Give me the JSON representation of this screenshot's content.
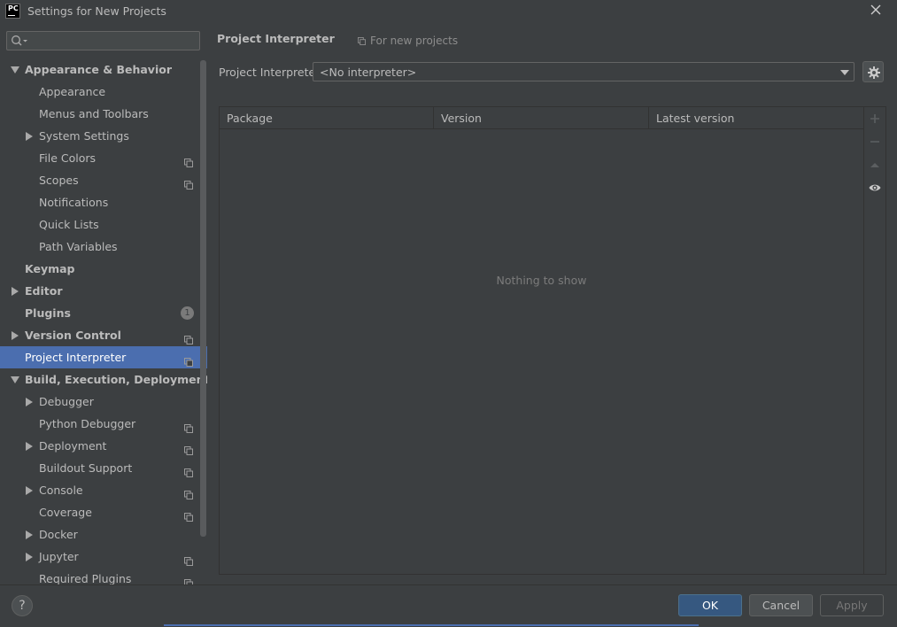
{
  "window": {
    "app_logo_text": "PC",
    "title": "Settings for New Projects"
  },
  "search": {
    "value": "",
    "placeholder": ""
  },
  "tree": [
    {
      "label": "Appearance & Behavior",
      "level": 0,
      "arrow": "down",
      "icon": null,
      "selected": false
    },
    {
      "label": "Appearance",
      "level": 1,
      "arrow": null,
      "icon": null,
      "selected": false
    },
    {
      "label": "Menus and Toolbars",
      "level": 1,
      "arrow": null,
      "icon": null,
      "selected": false
    },
    {
      "label": "System Settings",
      "level": 1,
      "arrow": "right",
      "icon": null,
      "selected": false
    },
    {
      "label": "File Colors",
      "level": 1,
      "arrow": null,
      "icon": "copy",
      "selected": false
    },
    {
      "label": "Scopes",
      "level": 1,
      "arrow": null,
      "icon": "copy",
      "selected": false
    },
    {
      "label": "Notifications",
      "level": 1,
      "arrow": null,
      "icon": null,
      "selected": false
    },
    {
      "label": "Quick Lists",
      "level": 1,
      "arrow": null,
      "icon": null,
      "selected": false
    },
    {
      "label": "Path Variables",
      "level": 1,
      "arrow": null,
      "icon": null,
      "selected": false
    },
    {
      "label": "Keymap",
      "level": 0,
      "arrow": null,
      "icon": null,
      "selected": false
    },
    {
      "label": "Editor",
      "level": 0,
      "arrow": "right",
      "icon": null,
      "selected": false
    },
    {
      "label": "Plugins",
      "level": 0,
      "arrow": null,
      "icon": "badge",
      "badge": "1",
      "selected": false
    },
    {
      "label": "Version Control",
      "level": 0,
      "arrow": "right",
      "icon": "copy",
      "selected": false
    },
    {
      "label": "Project Interpreter",
      "level": 0,
      "arrow": null,
      "icon": "copy",
      "selected": true
    },
    {
      "label": "Build, Execution, Deployment",
      "level": 0,
      "arrow": "down",
      "icon": null,
      "selected": false
    },
    {
      "label": "Debugger",
      "level": 1,
      "arrow": "right",
      "icon": null,
      "selected": false
    },
    {
      "label": "Python Debugger",
      "level": 1,
      "arrow": null,
      "icon": "copy",
      "selected": false
    },
    {
      "label": "Deployment",
      "level": 1,
      "arrow": "right",
      "icon": "copy",
      "selected": false
    },
    {
      "label": "Buildout Support",
      "level": 1,
      "arrow": null,
      "icon": "copy",
      "selected": false
    },
    {
      "label": "Console",
      "level": 1,
      "arrow": "right",
      "icon": "copy",
      "selected": false
    },
    {
      "label": "Coverage",
      "level": 1,
      "arrow": null,
      "icon": "copy",
      "selected": false
    },
    {
      "label": "Docker",
      "level": 1,
      "arrow": "right",
      "icon": null,
      "selected": false
    },
    {
      "label": "Jupyter",
      "level": 1,
      "arrow": "right",
      "icon": "copy",
      "selected": false
    },
    {
      "label": "Required Plugins",
      "level": 1,
      "arrow": null,
      "icon": "copy",
      "selected": false
    }
  ],
  "content": {
    "title": "Project Interpreter",
    "scope_label": "For new projects",
    "interpreter_label": "Project Interpreter:",
    "interpreter_value": "<No interpreter>",
    "table": {
      "columns": [
        "Package",
        "Version",
        "Latest version"
      ],
      "empty_text": "Nothing to show"
    }
  },
  "footer": {
    "help_label": "?",
    "ok_label": "OK",
    "cancel_label": "Cancel",
    "apply_label": "Apply"
  },
  "colors": {
    "background": "#3c3f41",
    "selection": "#4b6eaf",
    "default_button": "#365880",
    "text": "#bbbbbb"
  }
}
